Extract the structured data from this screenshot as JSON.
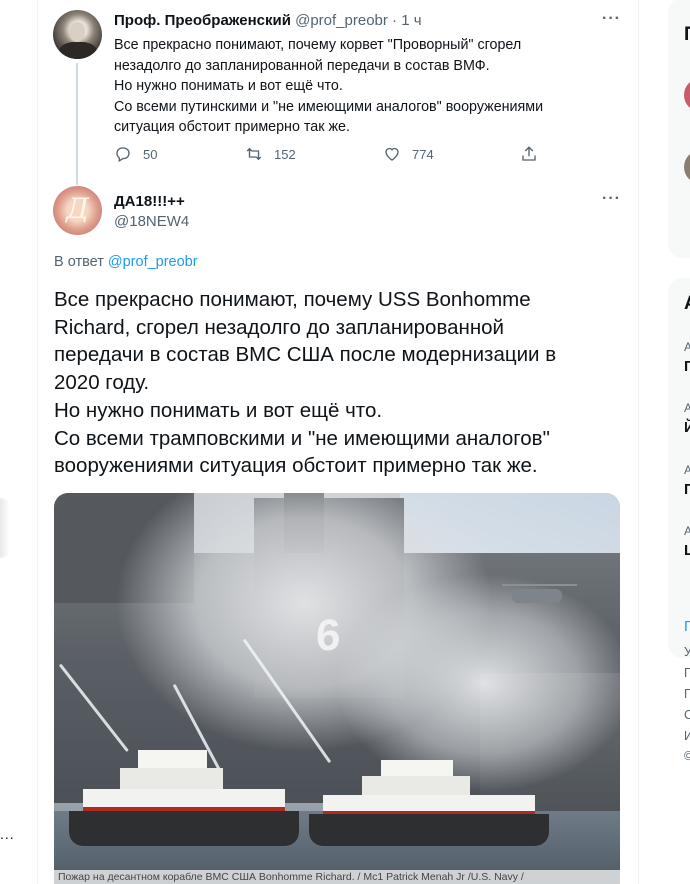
{
  "colors": {
    "accent": "#1d9bf0",
    "text": "#0f1419",
    "muted": "#536471"
  },
  "left_rail": {
    "more_label": "..."
  },
  "tweet1": {
    "author_name": "Проф. Преображенский",
    "handle": "@prof_preobr",
    "separator": "·",
    "time": "1 ч",
    "more_label": "···",
    "text_lines": [
      "Все прекрасно понимают, почему корвет \"Проворный\" сгорел",
      "незадолго до запланированной передачи в состав ВМФ.",
      "Но нужно понимать и вот ещё что.",
      "Со всеми путинскими и \"не имеющими аналогов\" вооружениями",
      "ситуация обстоит примерно так же."
    ],
    "replies": "50",
    "retweets": "152",
    "likes": "774",
    "icons": [
      "reply-icon",
      "retweet-icon",
      "like-icon",
      "share-icon"
    ]
  },
  "tweet2": {
    "author_name": "ДА18!!!++",
    "handle": "@18NEW4",
    "avatar_glyph": "Д",
    "more_label": "···",
    "reply_prefix": "В ответ",
    "reply_handle": "@prof_preobr",
    "text_lines": [
      "Все прекрасно понимают, почему USS Bonhomme",
      "Richard, сгорел незадолго до запланированной",
      "передачи в состав ВМС США после модернизации в",
      "2020 году.",
      "Но нужно понимать и вот ещё что.",
      "Со всеми трамповскими и \"не имеющими аналогов\"",
      "вооружениями ситуация обстоит примерно так же."
    ],
    "photo": {
      "hull_number": "6",
      "caption": "Пожар на десантном корабле ВМС США Bonhomme Richard. / Mc1 Patrick Menah Jr /U.S. Navy /"
    }
  },
  "sidebar": {
    "card1_title": "П",
    "card2_title": "А",
    "trends": [
      {
        "small": "А",
        "big": "П"
      },
      {
        "small": "А",
        "big": "Й"
      },
      {
        "small": "А",
        "big": "П"
      },
      {
        "small": "А",
        "big": "Ц"
      }
    ],
    "show_more": "П",
    "footer": [
      "У",
      "П",
      "П",
      "С",
      "И",
      "©"
    ]
  }
}
